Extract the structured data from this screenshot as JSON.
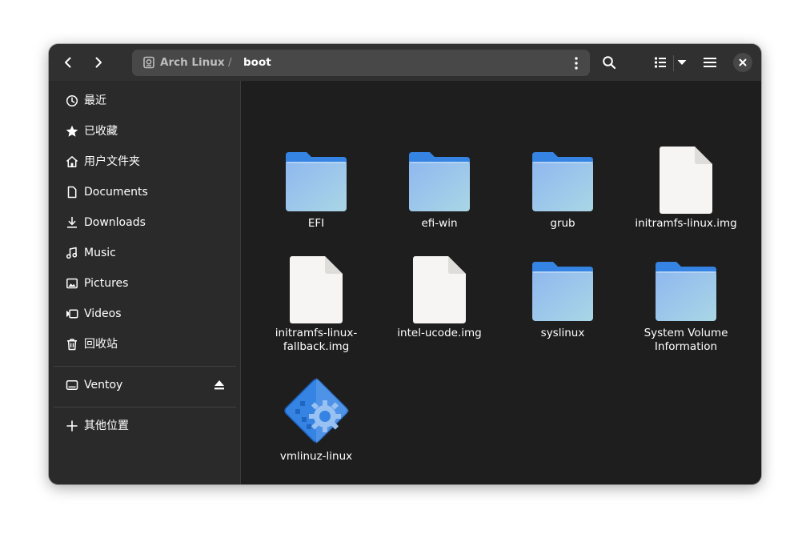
{
  "header": {
    "back_icon": "go-previous-icon",
    "forward_icon": "go-next-icon",
    "path": {
      "drive_icon": "drive-icon",
      "segments": [
        "Arch Linux",
        "boot"
      ],
      "separator": "/"
    },
    "search_icon": "search-icon",
    "view_icon": "view-list-icon",
    "view_dropdown_icon": "chevron-down-icon",
    "menu_icon": "hamburger-menu-icon",
    "close_icon": "close-icon"
  },
  "sidebar": {
    "places": [
      {
        "label": "最近",
        "icon": "clock-icon"
      },
      {
        "label": "已收藏",
        "icon": "star-icon"
      },
      {
        "label": "用户文件夹",
        "icon": "home-icon"
      },
      {
        "label": "Documents",
        "icon": "document-icon"
      },
      {
        "label": "Downloads",
        "icon": "download-icon"
      },
      {
        "label": "Music",
        "icon": "music-icon"
      },
      {
        "label": "Pictures",
        "icon": "picture-icon"
      },
      {
        "label": "Videos",
        "icon": "video-icon"
      },
      {
        "label": "回收站",
        "icon": "trash-icon"
      }
    ],
    "devices": [
      {
        "label": "Ventoy",
        "icon": "drive-icon",
        "eject_icon": "eject-icon"
      }
    ],
    "other": {
      "label": "其他位置",
      "icon": "plus-icon"
    }
  },
  "files": [
    {
      "name": "EFI",
      "type": "folder"
    },
    {
      "name": "efi-win",
      "type": "folder"
    },
    {
      "name": "grub",
      "type": "folder"
    },
    {
      "name": "initramfs-linux.img",
      "type": "file"
    },
    {
      "name_line1": "initramfs-linux-",
      "name_line2": "fallback.img",
      "type": "file"
    },
    {
      "name": "intel-ucode.img",
      "type": "file"
    },
    {
      "name": "syslinux",
      "type": "folder"
    },
    {
      "name_line1": "System Volume",
      "name_line2": "Information",
      "type": "folder"
    },
    {
      "name": "vmlinuz-linux",
      "type": "executable"
    }
  ],
  "colors": {
    "folder_tab": "#3584e4",
    "folder_front_top": "#99c1f1",
    "folder_front_bottom": "#a4d3e8",
    "file_page": "#f6f5f4",
    "headerbar": "#303030",
    "sidebar": "#2a2a2a",
    "content": "#1e1e1e"
  }
}
